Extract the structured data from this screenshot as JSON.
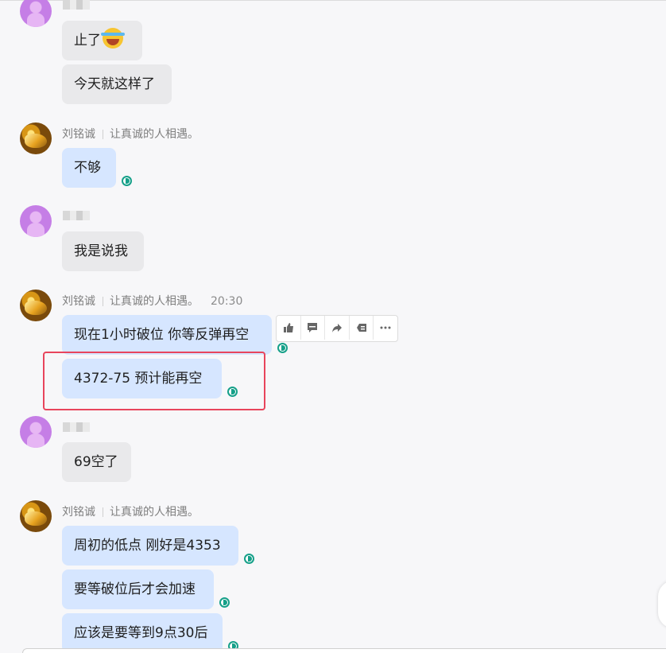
{
  "sender": {
    "name": "刘铭诚",
    "signature": "让真诚的人相遇。",
    "time": "20:30"
  },
  "messages": {
    "m1": "止了",
    "m2": "今天就这样了",
    "m3": "不够",
    "m4": "我是说我",
    "m5": "现在1小时破位  你等反弹再空",
    "m6": "4372-75   预计能再空",
    "m7": "69空了",
    "m8": "周初的低点  刚好是4353",
    "m9": "要等破位后才会加速",
    "m10": "应该是要等到9点30后"
  },
  "colors": {
    "self_bubble": "#d6e6ff",
    "other_bubble": "#e9e9eb",
    "read_indicator": "#16a089",
    "highlight_border": "#e8455c"
  },
  "icons": {
    "emoji": "laughing-tears-emoji",
    "toolbar": [
      "thumbs-up-icon",
      "comment-icon",
      "forward-icon",
      "quote-icon",
      "more-icon"
    ]
  }
}
